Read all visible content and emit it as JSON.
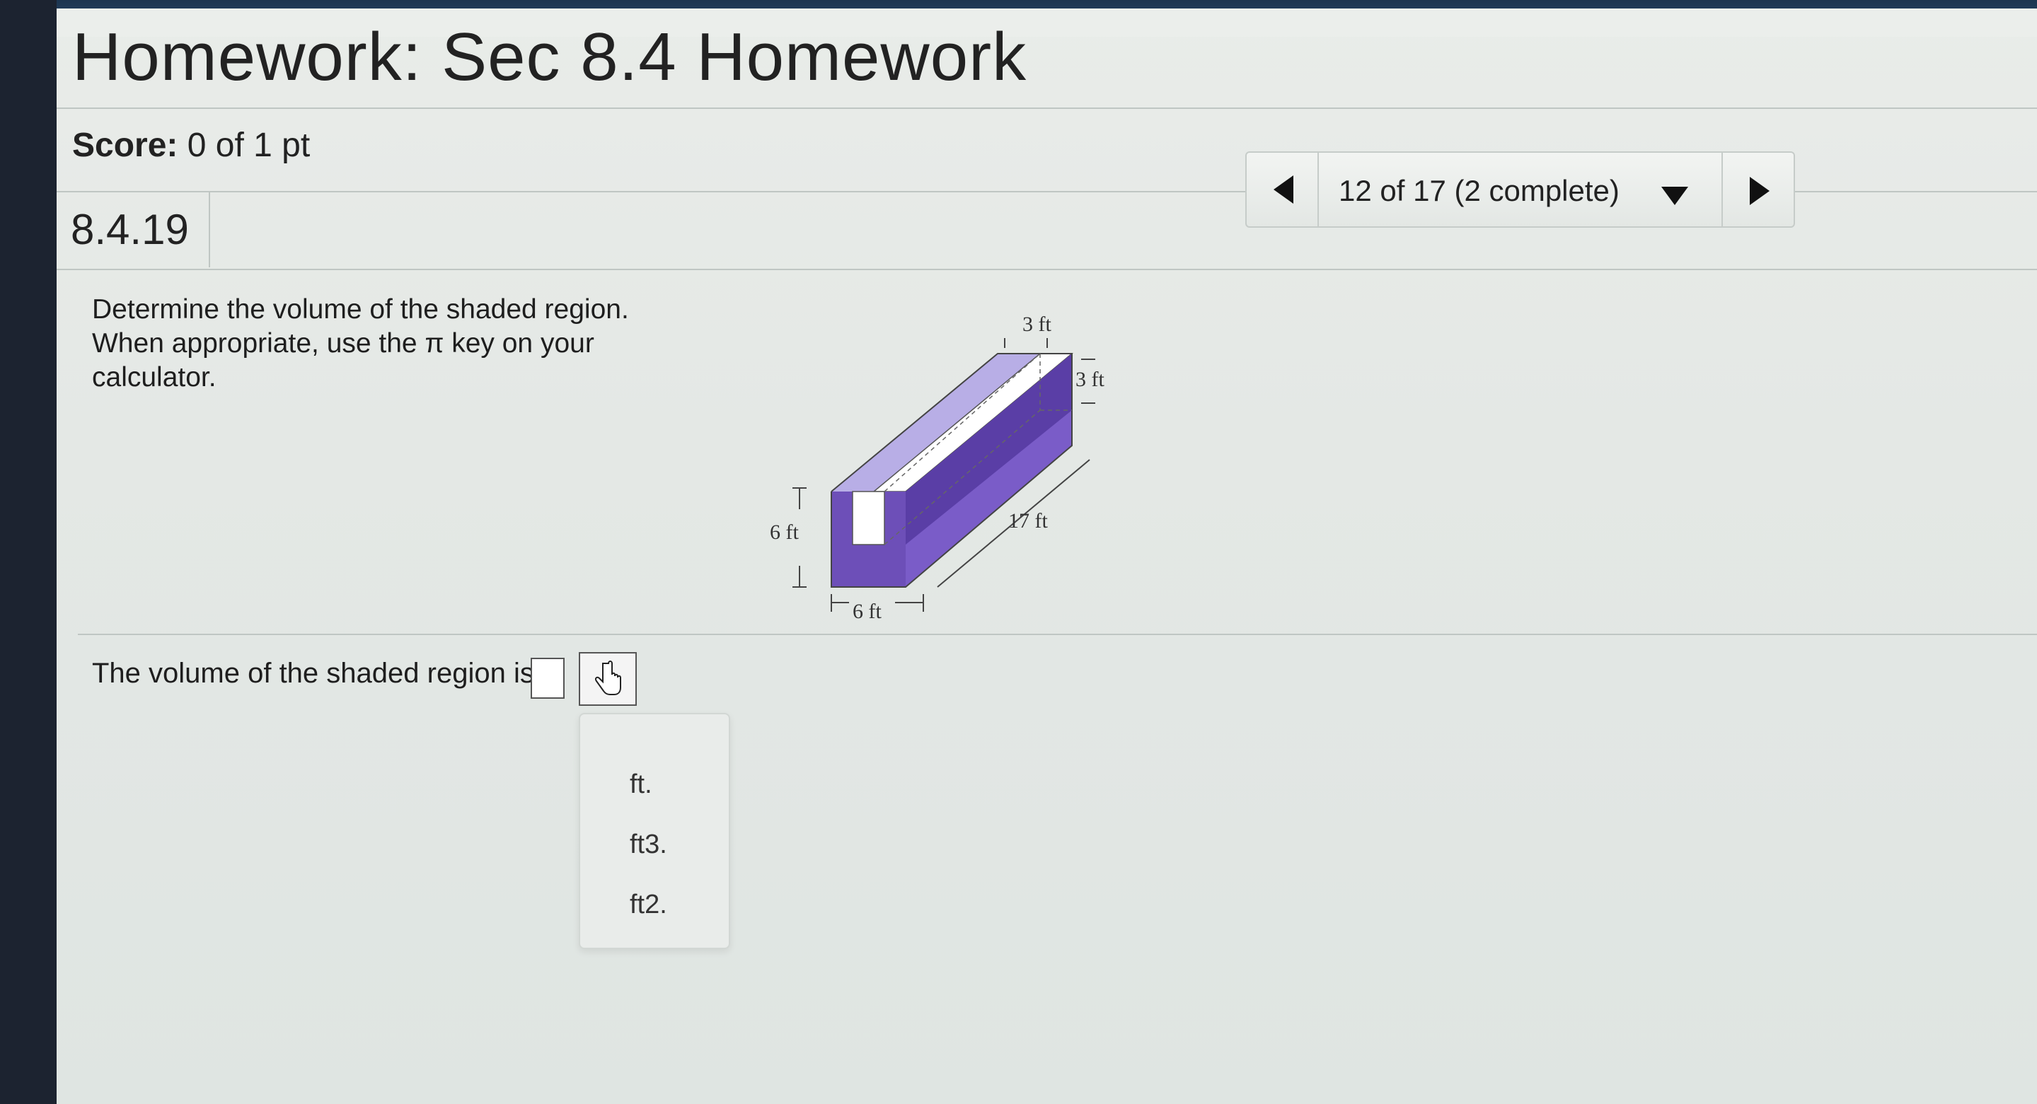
{
  "header": {
    "title": "Homework: Sec 8.4 Homework"
  },
  "score": {
    "label": "Score:",
    "value": "0 of 1 pt"
  },
  "question": {
    "number": "8.4.19",
    "prompt_line1": "Determine the volume of the shaded region.",
    "prompt_line2": "When appropriate, use the π key on your",
    "prompt_line3": "calculator."
  },
  "navigation": {
    "progress_label": "12 of 17 (2 complete)"
  },
  "figure": {
    "labels": {
      "top_width": "3 ft",
      "top_height": "3 ft",
      "outer_height": "6 ft",
      "length": "17 ft",
      "outer_width": "6 ft"
    },
    "colors": {
      "shade_dark": "#6d4fb8",
      "shade_light": "#b8aee6"
    }
  },
  "answer": {
    "label": "The volume of the shaded region is",
    "value": "",
    "unit_options": [
      "ft.",
      "ft3.",
      "ft2."
    ]
  }
}
